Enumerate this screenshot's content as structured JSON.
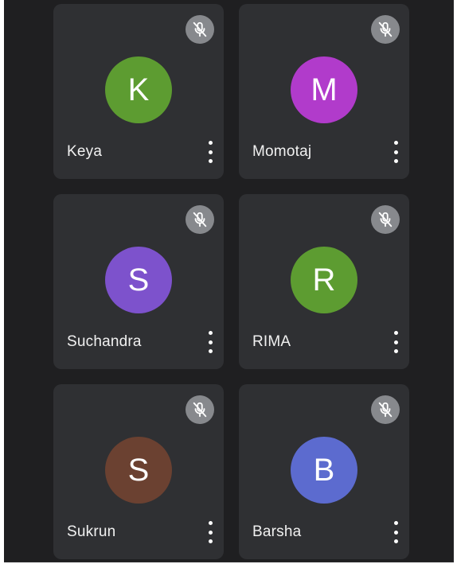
{
  "participants": [
    {
      "name": "Keya",
      "initial": "K",
      "color": "#5d9c31"
    },
    {
      "name": "Momotaj",
      "initial": "M",
      "color": "#b13bcb"
    },
    {
      "name": "Suchandra",
      "initial": "S",
      "color": "#7d52cc"
    },
    {
      "name": "RIMA",
      "initial": "R",
      "color": "#5d9c31"
    },
    {
      "name": "Sukrun",
      "initial": "S",
      "color": "#6b4131"
    },
    {
      "name": "Barsha",
      "initial": "B",
      "color": "#5c6bcf"
    }
  ],
  "icons": {
    "mute": "mic-off-icon",
    "more": "more-vert-icon"
  }
}
